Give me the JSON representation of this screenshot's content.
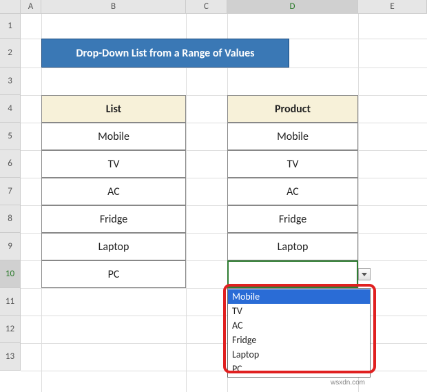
{
  "columns": {
    "corner": "",
    "A": "A",
    "B": "B",
    "C": "C",
    "D": "D",
    "E": "E"
  },
  "rows": {
    "r1": "1",
    "r2": "2",
    "r3": "3",
    "r4": "4",
    "r5": "5",
    "r6": "6",
    "r7": "7",
    "r8": "8",
    "r9": "9",
    "r10": "10",
    "r11": "11",
    "r12": "12",
    "r13": "13"
  },
  "banner": {
    "text": "Drop-Down List from a Range of Values"
  },
  "list": {
    "header": "List",
    "items": [
      "Mobile",
      "TV",
      "AC",
      "Fridge",
      "Laptop",
      "PC"
    ]
  },
  "product": {
    "header": "Product",
    "items": [
      "Mobile",
      "TV",
      "AC",
      "Fridge",
      "Laptop"
    ]
  },
  "dropdown": {
    "options": [
      "Mobile",
      "TV",
      "AC",
      "Fridge",
      "Laptop",
      "PC"
    ],
    "highlighted_index": 0
  },
  "watermark": "wsxdn.com",
  "chart_data": {
    "type": "table",
    "title": "Drop-Down List from a Range of Values",
    "series": [
      {
        "name": "List",
        "values": [
          "Mobile",
          "TV",
          "AC",
          "Fridge",
          "Laptop",
          "PC"
        ]
      },
      {
        "name": "Product",
        "values": [
          "Mobile",
          "TV",
          "AC",
          "Fridge",
          "Laptop",
          ""
        ]
      }
    ]
  }
}
